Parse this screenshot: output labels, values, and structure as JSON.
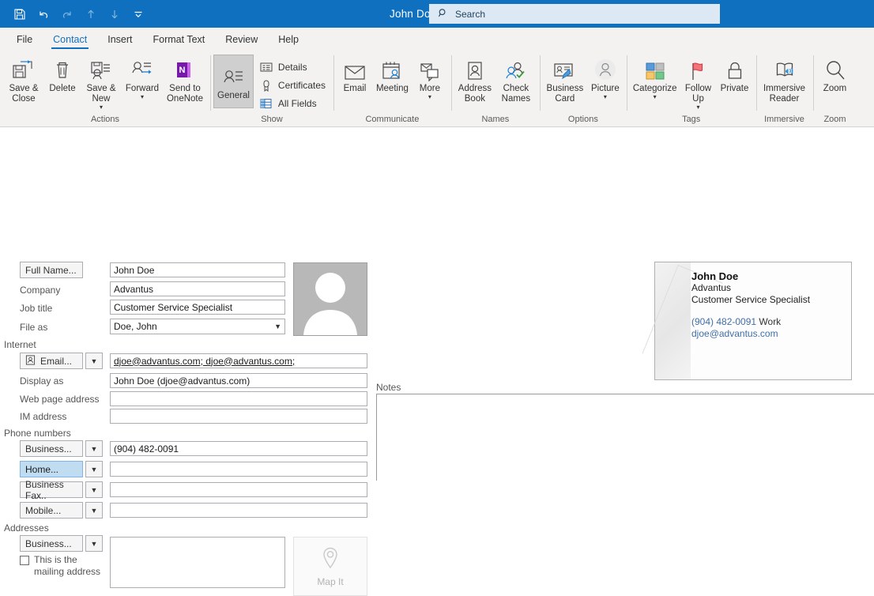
{
  "titlebar": {
    "title": "John Doe  -  Contact",
    "qat": [
      {
        "name": "save-icon",
        "label": "Save",
        "enabled": true
      },
      {
        "name": "undo-icon",
        "label": "Undo",
        "enabled": true
      },
      {
        "name": "redo-icon",
        "label": "Redo",
        "enabled": false
      },
      {
        "name": "previous-item-icon",
        "label": "Previous Item",
        "enabled": false
      },
      {
        "name": "next-item-icon",
        "label": "Next Item",
        "enabled": false
      },
      {
        "name": "customize-quick-access-toolbar-icon",
        "label": "Customize Quick Access Toolbar",
        "enabled": true
      }
    ],
    "search": {
      "placeholder": "Search",
      "value": "",
      "icon": "search-icon"
    }
  },
  "tabs": [
    {
      "label": "File",
      "active": false
    },
    {
      "label": "Contact",
      "active": true
    },
    {
      "label": "Insert",
      "active": false
    },
    {
      "label": "Format Text",
      "active": false
    },
    {
      "label": "Review",
      "active": false
    },
    {
      "label": "Help",
      "active": false
    }
  ],
  "ribbon": {
    "groups": [
      {
        "label": "Actions",
        "buttons": [
          {
            "label": "Save &\nClose",
            "icon": "save-and-close-icon",
            "dropdown": false
          },
          {
            "label": "Delete",
            "icon": "delete-trash-icon",
            "dropdown": false
          },
          {
            "label": "Save &\nNew",
            "icon": "save-and-new-icon",
            "dropdown": true
          },
          {
            "label": "Forward",
            "icon": "forward-contact-icon",
            "dropdown": true
          },
          {
            "label": "Send to\nOneNote",
            "icon": "onenote-icon",
            "dropdown": false
          }
        ]
      },
      {
        "label": "Show",
        "buttons": [
          {
            "label": "General",
            "icon": "contact-person-icon",
            "selected": true,
            "dropdown": false
          }
        ],
        "small_buttons": [
          {
            "label": "Details",
            "icon": "details-icon"
          },
          {
            "label": "Certificates",
            "icon": "certificate-icon"
          },
          {
            "label": "All Fields",
            "icon": "all-fields-table-icon"
          }
        ]
      },
      {
        "label": "Communicate",
        "buttons": [
          {
            "label": "Email",
            "icon": "email-envelope-icon",
            "dropdown": false
          },
          {
            "label": "Meeting",
            "icon": "meeting-calendar-icon",
            "dropdown": false
          },
          {
            "label": "More",
            "icon": "more-messages-icon",
            "dropdown": true
          }
        ]
      },
      {
        "label": "Names",
        "buttons": [
          {
            "label": "Address\nBook",
            "icon": "address-book-icon",
            "dropdown": false
          },
          {
            "label": "Check\nNames",
            "icon": "check-names-icon",
            "dropdown": false
          }
        ]
      },
      {
        "label": "Options",
        "buttons": [
          {
            "label": "Business\nCard",
            "icon": "business-card-icon",
            "dropdown": false
          },
          {
            "label": "Picture",
            "icon": "picture-person-icon",
            "dropdown": true
          }
        ]
      },
      {
        "label": "Tags",
        "buttons": [
          {
            "label": "Categorize",
            "icon": "categorize-colors-icon",
            "dropdown": true
          },
          {
            "label": "Follow\nUp",
            "icon": "follow-up-flag-icon",
            "dropdown": true
          },
          {
            "label": "Private",
            "icon": "private-lock-icon",
            "dropdown": false
          }
        ]
      },
      {
        "label": "Immersive",
        "buttons": [
          {
            "label": "Immersive\nReader",
            "icon": "immersive-reader-icon",
            "dropdown": false
          }
        ]
      },
      {
        "label": "Zoom",
        "buttons": [
          {
            "label": "Zoom",
            "icon": "zoom-magnifier-icon",
            "dropdown": false
          }
        ]
      }
    ]
  },
  "form": {
    "full_name_button": "Full Name...",
    "full_name_value": "John Doe",
    "company_label": "Company",
    "company_value": "Advantus",
    "job_title_label": "Job title",
    "job_title_value": "Customer Service Specialist",
    "file_as_label": "File as",
    "file_as_value": "Doe, John",
    "internet_section": "Internet",
    "email_button": "Email...",
    "email_value": "djoe@advantus.com; djoe@advantus.com;",
    "display_as_label": "Display as",
    "display_as_value": "John Doe (djoe@advantus.com)",
    "web_page_label": "Web page address",
    "web_page_value": "",
    "im_address_label": "IM address",
    "im_address_value": "",
    "phone_section": "Phone numbers",
    "phones": [
      {
        "type": "Business...",
        "value": "(904) 482-0091",
        "highlighted": false
      },
      {
        "type": "Home...",
        "value": "",
        "highlighted": true
      },
      {
        "type": "Business Fax..",
        "value": "",
        "highlighted": false
      },
      {
        "type": "Mobile...",
        "value": "",
        "highlighted": false
      }
    ],
    "addresses_section": "Addresses",
    "address_type": "Business...",
    "address_value": "",
    "mailing_checkbox_label": "This is the\nmailing address",
    "mailing_checked": false,
    "map_it_label": "Map It",
    "notes_label": "Notes",
    "notes_value": "",
    "photo_alt": "contact-photo-placeholder"
  },
  "business_card": {
    "name": "John Doe",
    "company": "Advantus",
    "title": "Customer Service Specialist",
    "phone": "(904) 482-0091",
    "phone_label": "Work",
    "email": "djoe@advantus.com"
  },
  "colors": {
    "titlebar": "#1070c0",
    "ribbon": "#f3f2f1",
    "accent": "#1070c0",
    "search_bg": "#dce9f5",
    "highlight": "#bfdcf0",
    "card_link": "#3f6fa8"
  }
}
